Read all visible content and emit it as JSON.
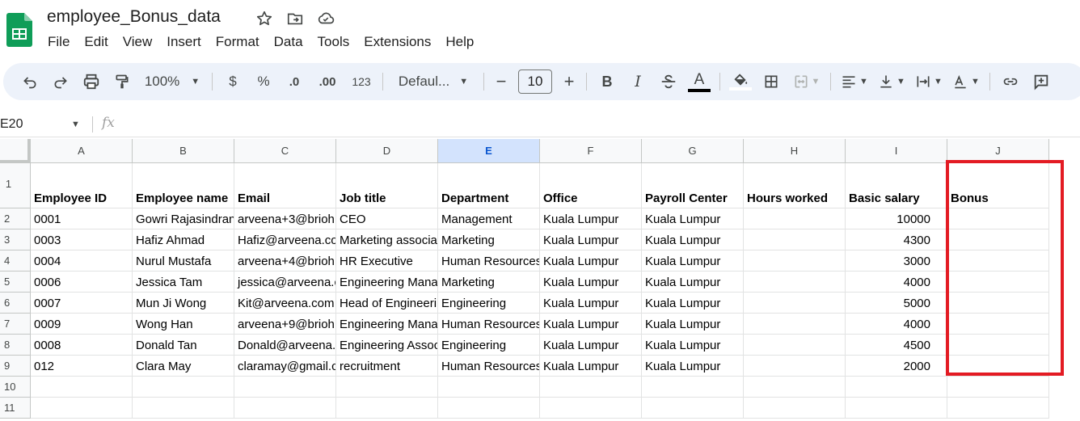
{
  "doc": {
    "title": "employee_Bonus_data"
  },
  "menu": [
    "File",
    "Edit",
    "View",
    "Insert",
    "Format",
    "Data",
    "Tools",
    "Extensions",
    "Help"
  ],
  "toolbar": {
    "zoom": "100%",
    "currency": "$",
    "percent": "%",
    "decrease_decimal": ".0",
    "increase_decimal": ".00",
    "number_format": "123",
    "font": "Defaul...",
    "font_size": "10",
    "minus": "−",
    "plus": "+",
    "bold": "B",
    "italic": "I",
    "text_color_letter": "A",
    "text_color": "#000000",
    "fill_color": "#ffffff"
  },
  "formula_bar": {
    "cell_ref": "E20",
    "fx": "fx"
  },
  "grid": {
    "columns": [
      "A",
      "B",
      "C",
      "D",
      "E",
      "F",
      "G",
      "H",
      "I",
      "J"
    ],
    "selected_column": "E",
    "row_numbers": [
      "1",
      "2",
      "3",
      "4",
      "5",
      "6",
      "7",
      "8",
      "9",
      "10",
      "11"
    ],
    "header_row": [
      "Employee ID",
      "Employee name",
      "Email",
      "Job title",
      "Department",
      "Office",
      "Payroll Center",
      "Hours worked",
      "Basic salary",
      "Bonus"
    ],
    "rows": [
      [
        "0001",
        "Gowri Rajasindran",
        "arveena+3@brioh",
        "CEO",
        "Management",
        "Kuala Lumpur",
        "Kuala Lumpur",
        "",
        "10000",
        ""
      ],
      [
        "0003",
        "Hafiz Ahmad",
        "Hafiz@arveena.co",
        "Marketing associa",
        "Marketing",
        "Kuala Lumpur",
        "Kuala Lumpur",
        "",
        "4300",
        ""
      ],
      [
        "0004",
        "Nurul Mustafa",
        "arveena+4@brioh",
        "HR Executive",
        "Human Resources",
        "Kuala Lumpur",
        "Kuala Lumpur",
        "",
        "3000",
        ""
      ],
      [
        "0006",
        "Jessica Tam",
        "jessica@arveena.c",
        "Engineering Mana",
        "Marketing",
        "Kuala Lumpur",
        "Kuala Lumpur",
        "",
        "4000",
        ""
      ],
      [
        "0007",
        "Mun Ji Wong",
        "Kit@arveena.com",
        "Head of Engineeri",
        "Engineering",
        "Kuala Lumpur",
        "Kuala Lumpur",
        "",
        "5000",
        ""
      ],
      [
        "0009",
        "Wong Han",
        "arveena+9@brioh",
        "Engineering Mana",
        "Human Resources",
        "Kuala Lumpur",
        "Kuala Lumpur",
        "",
        "4000",
        ""
      ],
      [
        "0008",
        "Donald Tan",
        "Donald@arveena.",
        "Engineering Assoc",
        "Engineering",
        "Kuala Lumpur",
        "Kuala Lumpur",
        "",
        "4500",
        ""
      ],
      [
        "012",
        "Clara May",
        "claramay@gmail.c",
        "recruitment",
        "Human Resources",
        "Kuala Lumpur",
        "Kuala Lumpur",
        "",
        "2000",
        ""
      ],
      [
        "",
        "",
        "",
        "",
        "",
        "",
        "",
        "",
        "",
        ""
      ],
      [
        "",
        "",
        "",
        "",
        "",
        "",
        "",
        "",
        "",
        ""
      ]
    ]
  },
  "colors": {
    "highlight": "#e31b23",
    "selected_col_bg": "#d3e3fd",
    "toolbar_bg": "#edf2fa"
  }
}
